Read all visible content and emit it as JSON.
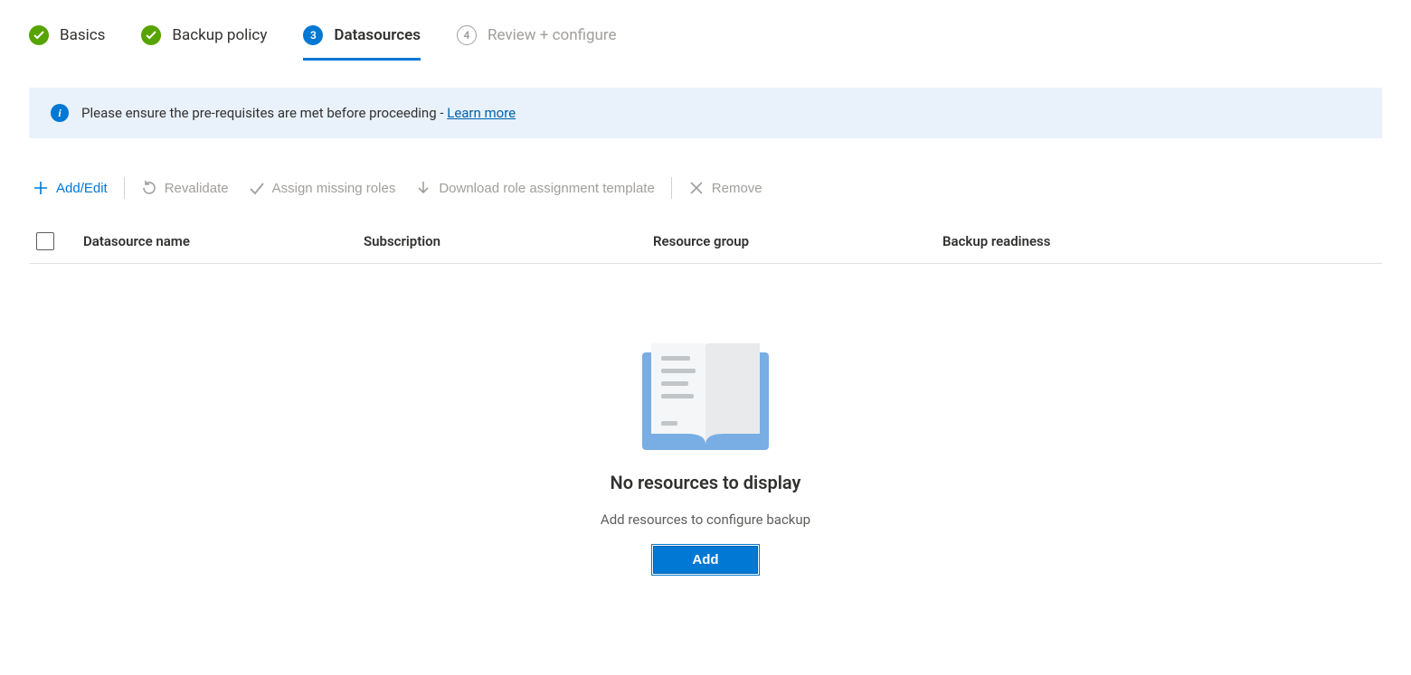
{
  "wizard": {
    "steps": [
      {
        "label": "Basics",
        "status": "done",
        "number": ""
      },
      {
        "label": "Backup policy",
        "status": "done",
        "number": ""
      },
      {
        "label": "Datasources",
        "status": "current",
        "number": "3"
      },
      {
        "label": "Review + configure",
        "status": "pending",
        "number": "4"
      }
    ]
  },
  "info": {
    "message": "Please ensure the pre-requisites are met before proceeding - ",
    "link_label": "Learn more"
  },
  "toolbar": {
    "add_edit": "Add/Edit",
    "revalidate": "Revalidate",
    "assign": "Assign missing roles",
    "download": "Download role assignment template",
    "remove": "Remove"
  },
  "table": {
    "columns": {
      "name": "Datasource name",
      "subscription": "Subscription",
      "rg": "Resource group",
      "readiness": "Backup readiness"
    }
  },
  "empty": {
    "title": "No resources to display",
    "sub": "Add resources to configure backup",
    "button": "Add"
  }
}
